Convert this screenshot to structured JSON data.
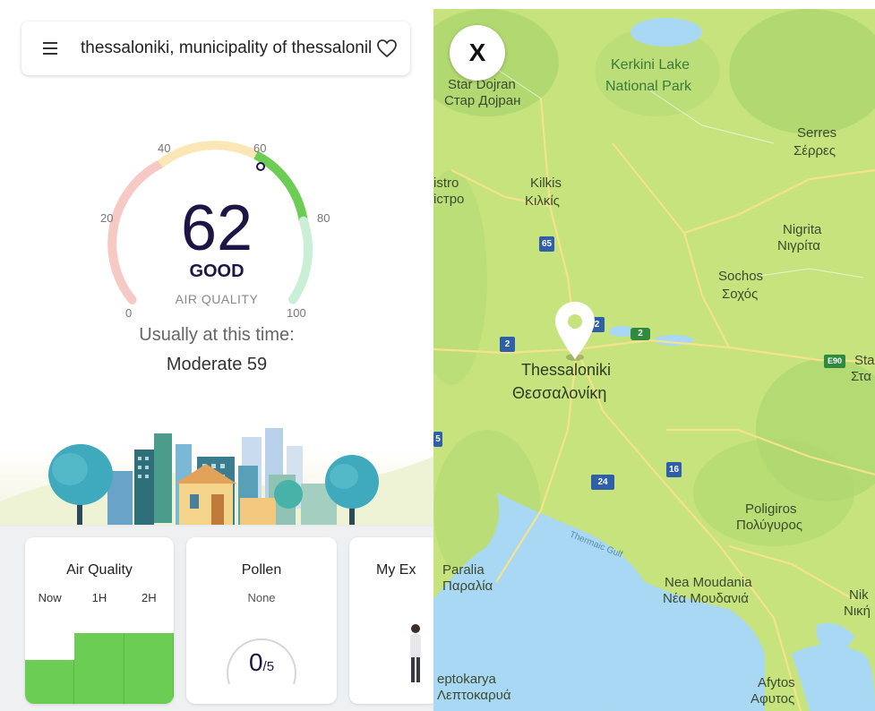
{
  "search": {
    "location": "thessaloniki, municipality of thessaloniki"
  },
  "gauge": {
    "ticks": [
      "0",
      "20",
      "40",
      "60",
      "80",
      "100"
    ],
    "value": "62",
    "value_fraction": 0.62,
    "category": "GOOD",
    "label": "AIR QUALITY",
    "usual_label": "Usually at this time:",
    "usual_value": "Moderate 59",
    "colors": {
      "low": "#f6c9c4",
      "mid": "#fbe7b5",
      "good": "#6ccd55",
      "high": "#c9efd6"
    }
  },
  "cards": {
    "air_quality": {
      "title": "Air Quality",
      "tabs": [
        "Now",
        "1H",
        "2H"
      ],
      "levels": [
        0.41,
        0.66,
        0.66
      ],
      "bar_color": "#6ccd55"
    },
    "pollen": {
      "title": "Pollen",
      "level": "None",
      "value": "0",
      "max": "/5"
    },
    "my_exposure": {
      "title": "My Ex"
    }
  },
  "map": {
    "close_label": "X",
    "labels": {
      "star_dojran": "Star Dojran",
      "star_dojran_cyr": "Стар Дојран",
      "kerkini_1": "Kerkini Lake",
      "kerkini_2": "National Park",
      "serres": "Serres",
      "serres_gr": "Σέρρες",
      "kilkis": "Kilkis",
      "kilkis_gr": "Κιλκίς",
      "istro": "istro",
      "istro_cyr": "істро",
      "nigrita": "Nigrita",
      "nigrita_gr": "Νιγρίτα",
      "sochos": "Sochos",
      "sochos_gr": "Σοχός",
      "thessaloniki": "Thessaloniki",
      "thessaloniki_gr": "Θεσσαλονίκη",
      "sta": "Sta",
      "sta_gr": "Στα",
      "poligiros": "Poligiros",
      "poligiros_gr": "Πολύγυρος",
      "paralia": "Paralia",
      "paralia_gr": "Παραλία",
      "nea_moudania": "Nea Moudania",
      "nea_moudania_gr": "Νέα Μουδανιά",
      "nik": "Nik",
      "nik_gr": "Νική",
      "leptokarya": "eptokarya",
      "leptokarya_gr": "Λεπτοκαρυά",
      "afytos": "Afytos",
      "afytos_gr": "Αφυτος",
      "gulf": "Thermaic Gulf"
    },
    "shields": {
      "r65": "65",
      "r2a": "2",
      "r2b": "2",
      "r2c": "2",
      "r24": "24",
      "r16": "16",
      "e90": "E90",
      "r5": "5"
    },
    "colors": {
      "land": "#c6e37e",
      "water": "#a9d8f5",
      "forest": "#9dcf6a"
    }
  }
}
